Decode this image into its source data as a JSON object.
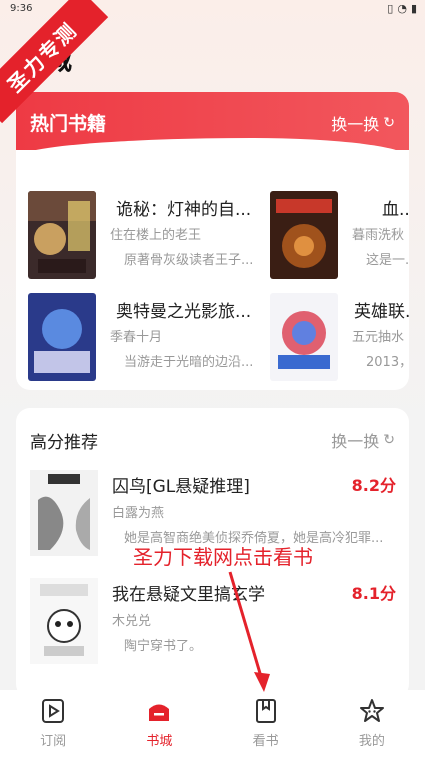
{
  "status_bar": {
    "time": "9:36",
    "icons": [
      "vibrate-icon",
      "wifi-icon",
      "battery-icon"
    ]
  },
  "page_title": "城",
  "watermark": "圣力专测",
  "hot_section": {
    "title": "热门书籍",
    "refresh_label": "换一换",
    "books": [
      {
        "name": "诡秘：灯神的自...",
        "author": "住在楼上的老王",
        "desc": "原著骨灰级读者王子..."
      },
      {
        "name": "血...",
        "author": "暮雨洗秋",
        "desc": "这是一..."
      },
      {
        "name": "奥特曼之光影旅...",
        "author": "季春十月",
        "desc": "当游走于光暗的边沿..."
      },
      {
        "name": "英雄联...",
        "author": "五元抽水",
        "desc": "2013，..."
      }
    ]
  },
  "score_section": {
    "title": "高分推荐",
    "refresh_label": "换一换",
    "books": [
      {
        "name": "囚鸟[GL悬疑推理]",
        "author": "白露为燕",
        "desc": "她是高智商绝美侦探乔倚夏，她是高冷犯罪...",
        "score": "8.2分"
      },
      {
        "name": "我在悬疑文里搞玄学",
        "author": "木兑兑",
        "desc": "陶宁穿书了。",
        "score": "8.1分"
      }
    ]
  },
  "overlay_text": "圣力下载网点击看书",
  "nav": {
    "items": [
      {
        "label": "订阅",
        "icon": "subscribe-icon"
      },
      {
        "label": "书城",
        "icon": "bookstore-icon"
      },
      {
        "label": "看书",
        "icon": "read-book-icon"
      },
      {
        "label": "我的",
        "icon": "profile-star-icon"
      }
    ],
    "active_color": "#e4222b",
    "inactive_color": "#999999"
  },
  "colors": {
    "accent": "#e4222b",
    "header_gradient_start": "#ee3a44",
    "header_gradient_end": "#f2575d"
  }
}
